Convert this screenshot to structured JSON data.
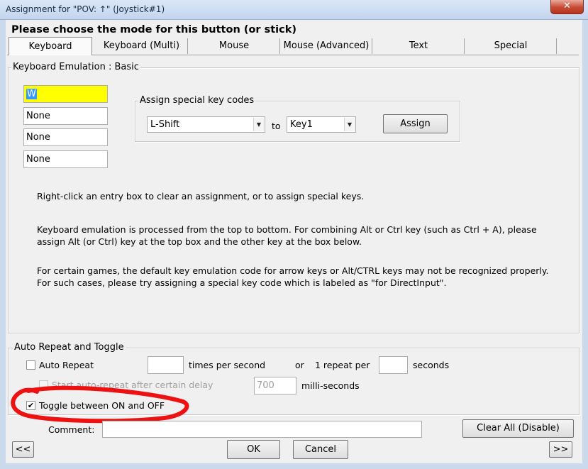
{
  "window": {
    "title": "Assignment for \"POV: ↑\" (Joystick#1)",
    "close_glyph": "✕"
  },
  "heading": "Please choose the mode for this button (or stick)",
  "tabs": [
    {
      "label": "Keyboard",
      "active": true
    },
    {
      "label": "Keyboard (Multi)"
    },
    {
      "label": "Mouse"
    },
    {
      "label": "Mouse (Advanced)"
    },
    {
      "label": "Text"
    },
    {
      "label": "Special"
    }
  ],
  "keyboard_group": {
    "label": "Keyboard Emulation : Basic",
    "entries": [
      "W",
      "None",
      "None",
      "None"
    ],
    "special": {
      "label": "Assign special key codes",
      "from_value": "L-Shift",
      "to_label": "to",
      "to_value": "Key1",
      "assign_label": "Assign"
    },
    "help": [
      "Right-click an entry box to clear an assignment, or to assign special keys.",
      "Keyboard emulation is processed from the top to bottom.  For combining Alt or Ctrl key (such as Ctrl + A), please",
      "assign Alt (or Ctrl) key at the top box and the other key at the box below.",
      "For certain games, the default key emulation code for arrow keys or Alt/CTRL keys may not be recognized properly.",
      "For such cases, please try assigning a special key code which is labeled as \"for DirectInput\"."
    ]
  },
  "repeat_group": {
    "label": "Auto Repeat and Toggle",
    "auto_repeat_label": "Auto Repeat",
    "auto_repeat_checked": false,
    "times_value": "",
    "times_label": "times per second",
    "or_label": "or",
    "repeat_per_label": "1 repeat per",
    "seconds_value": "",
    "seconds_label": "seconds",
    "delay_label": "Start auto-repeat after certain delay",
    "delay_value": "700",
    "delay_unit": "milli-seconds",
    "toggle_label": "Toggle between ON and OFF",
    "toggle_checked": true,
    "check_glyph": "✔"
  },
  "comment_label": "Comment:",
  "comment_value": "",
  "buttons": {
    "clear_all": "Clear All (Disable)",
    "prev": "<<",
    "next": ">>",
    "ok": "OK",
    "cancel": "Cancel"
  },
  "annotation_color": "#ee1111"
}
